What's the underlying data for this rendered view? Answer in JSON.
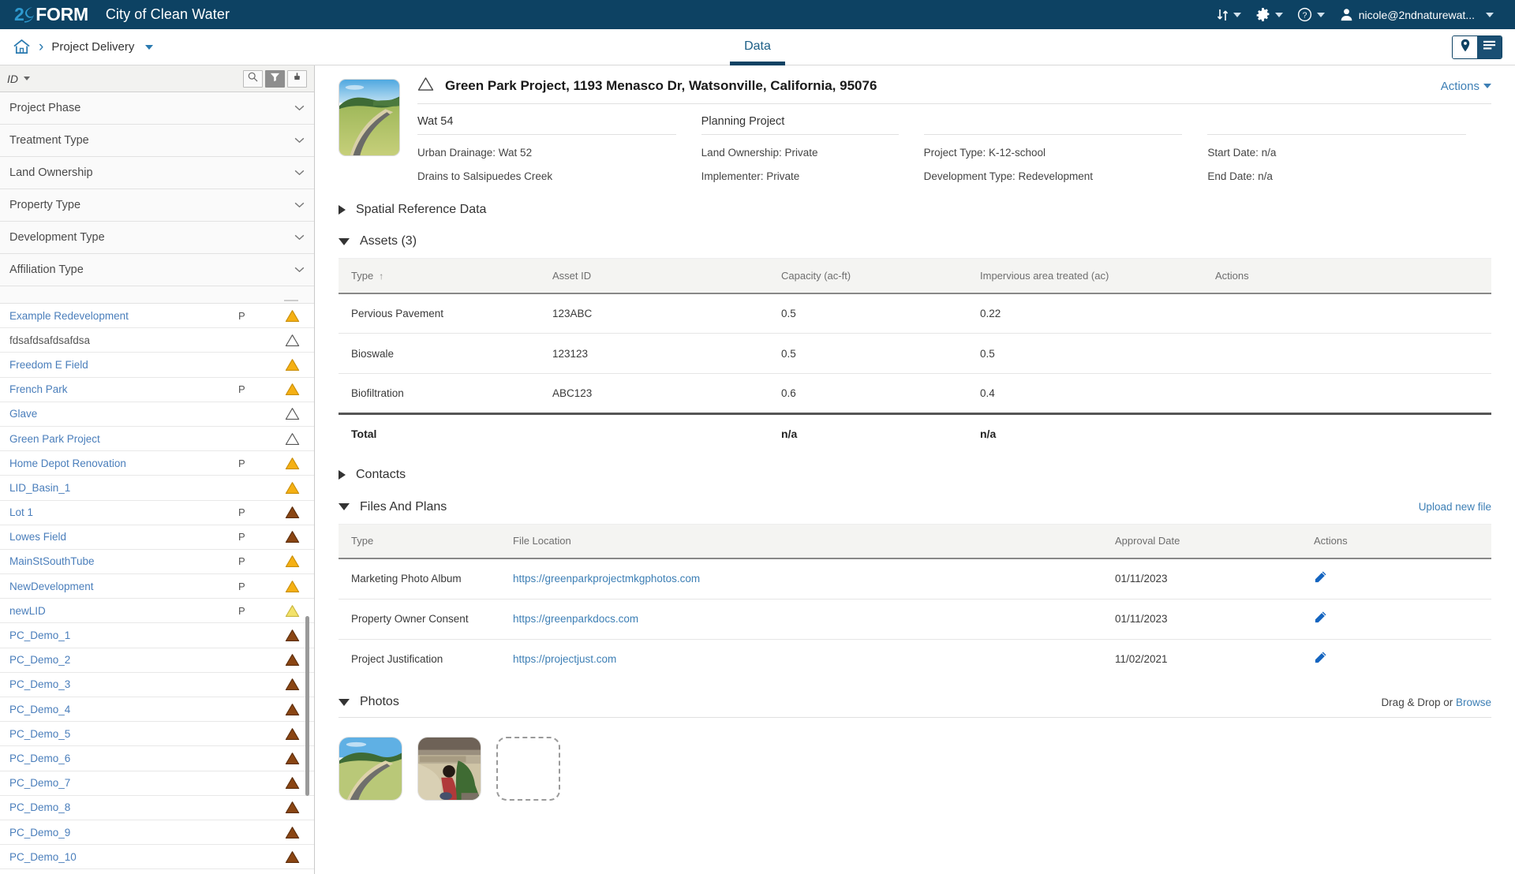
{
  "topbar": {
    "logo_number": "2",
    "logo_word": "FORM",
    "brand_title": "City of Clean Water",
    "sort_icon": "sort-arrows-icon",
    "gear_icon": "gear-icon",
    "help_icon": "help-circle-icon",
    "avatar_icon": "user-avatar-icon",
    "user_label": "nicole@2ndnaturewat...",
    "accent": "#0d4263"
  },
  "breadcrumb": {
    "home_icon": "home-icon",
    "separator": "›",
    "label": "Project Delivery",
    "tab_label": "Data",
    "map_view_icon": "map-pin-icon",
    "list_view_icon": "list-lines-icon"
  },
  "sidebar": {
    "header": {
      "label": "ID",
      "search_icon": "search-icon",
      "filter_icon": "filter-funnel-icon",
      "download_icon": "download-arrow-icon"
    },
    "filters": [
      {
        "label": "Project Phase"
      },
      {
        "label": "Treatment Type"
      },
      {
        "label": "Land Ownership"
      },
      {
        "label": "Property Type"
      },
      {
        "label": "Development Type"
      },
      {
        "label": "Affiliation Type"
      }
    ],
    "projects": [
      {
        "name": "Example Redevelopment",
        "flag": "P",
        "status": "amber"
      },
      {
        "name": "fdsafdsafdsafdsa",
        "flag": "",
        "status": "empty",
        "muted": true
      },
      {
        "name": "Freedom E Field",
        "flag": "",
        "status": "amber"
      },
      {
        "name": "French Park",
        "flag": "P",
        "status": "amber"
      },
      {
        "name": "Glave",
        "flag": "",
        "status": "empty"
      },
      {
        "name": "Green Park Project",
        "flag": "",
        "status": "empty"
      },
      {
        "name": "Home Depot Renovation",
        "flag": "P",
        "status": "amber"
      },
      {
        "name": "LID_Basin_1",
        "flag": "",
        "status": "amber"
      },
      {
        "name": "Lot 1",
        "flag": "P",
        "status": "brown"
      },
      {
        "name": "Lowes Field",
        "flag": "P",
        "status": "brown"
      },
      {
        "name": "MainStSouthTube",
        "flag": "P",
        "status": "amber"
      },
      {
        "name": "NewDevelopment",
        "flag": "P",
        "status": "amber"
      },
      {
        "name": "newLID",
        "flag": "P",
        "status": "yellow"
      },
      {
        "name": "PC_Demo_1",
        "flag": "",
        "status": "brown"
      },
      {
        "name": "PC_Demo_2",
        "flag": "",
        "status": "brown"
      },
      {
        "name": "PC_Demo_3",
        "flag": "",
        "status": "brown"
      },
      {
        "name": "PC_Demo_4",
        "flag": "",
        "status": "brown"
      },
      {
        "name": "PC_Demo_5",
        "flag": "",
        "status": "brown"
      },
      {
        "name": "PC_Demo_6",
        "flag": "",
        "status": "brown"
      },
      {
        "name": "PC_Demo_7",
        "flag": "",
        "status": "brown"
      },
      {
        "name": "PC_Demo_8",
        "flag": "",
        "status": "brown"
      },
      {
        "name": "PC_Demo_9",
        "flag": "",
        "status": "brown"
      },
      {
        "name": "PC_Demo_10",
        "flag": "",
        "status": "brown"
      }
    ]
  },
  "project": {
    "status_icon": "warning-triangle-outline-icon",
    "title": "Green Park Project, 1193 Menasco Dr, Watsonville, California, 95076",
    "actions_label": "Actions",
    "thumbnail_alt": "road-through-hills-photo",
    "col1": {
      "heading": "Wat 54",
      "lines": [
        "Urban Drainage: Wat 52",
        "Drains to Salsipuedes Creek"
      ]
    },
    "col2": {
      "heading": "Planning Project",
      "lines": [
        "Land Ownership: Private",
        "Implementer: Private"
      ]
    },
    "col3": {
      "heading": "",
      "lines": [
        "Project Type: K-12-school",
        "Development Type: Redevelopment"
      ]
    },
    "col4": {
      "heading": "",
      "lines": [
        "Start Date: n/a",
        "End Date: n/a"
      ]
    }
  },
  "sections": {
    "spatial": {
      "title": "Spatial Reference Data",
      "expanded": false
    },
    "assets": {
      "title": "Assets (3)",
      "expanded": true,
      "columns": [
        "Type",
        "Asset ID",
        "Capacity (ac-ft)",
        "Impervious area treated (ac)",
        "Actions"
      ],
      "sorted_column": "Type",
      "sort_direction": "asc",
      "rows": [
        {
          "type": "Pervious Pavement",
          "asset_id": "123ABC",
          "capacity": "0.5",
          "impervious": "0.22",
          "actions": ""
        },
        {
          "type": "Bioswale",
          "asset_id": "123123",
          "capacity": "0.5",
          "impervious": "0.5",
          "actions": ""
        },
        {
          "type": "Biofiltration",
          "asset_id": "ABC123",
          "capacity": "0.6",
          "impervious": "0.4",
          "actions": ""
        }
      ],
      "total": {
        "label": "Total",
        "asset_id": "",
        "capacity": "n/a",
        "impervious": "n/a"
      }
    },
    "contacts": {
      "title": "Contacts",
      "expanded": false
    },
    "files": {
      "title": "Files And Plans",
      "expanded": true,
      "upload_label": "Upload new file",
      "columns": [
        "Type",
        "File Location",
        "Approval Date",
        "Actions"
      ],
      "rows": [
        {
          "type": "Marketing Photo Album",
          "location": "https://greenparkprojectmkgphotos.com",
          "date": "01/11/2023",
          "edit_icon": "pencil-edit-icon"
        },
        {
          "type": "Property Owner Consent",
          "location": "https://greenparkdocs.com",
          "date": "01/11/2023",
          "edit_icon": "pencil-edit-icon"
        },
        {
          "type": "Project Justification",
          "location": "https://projectjust.com",
          "date": "11/02/2021",
          "edit_icon": "pencil-edit-icon"
        }
      ]
    },
    "photos": {
      "title": "Photos",
      "expanded": true,
      "drag_text": "Drag & Drop or ",
      "browse_label": "Browse",
      "tiles": [
        "hillside-road-photo",
        "person-sitting-by-culvert-photo",
        "empty-drop-slot"
      ]
    }
  },
  "colors": {
    "brand_navy": "#0d4263",
    "link_blue": "#3d7fb5",
    "amber": "#f5b014",
    "brown": "#8a4513",
    "yellow": "#f3e26a"
  }
}
